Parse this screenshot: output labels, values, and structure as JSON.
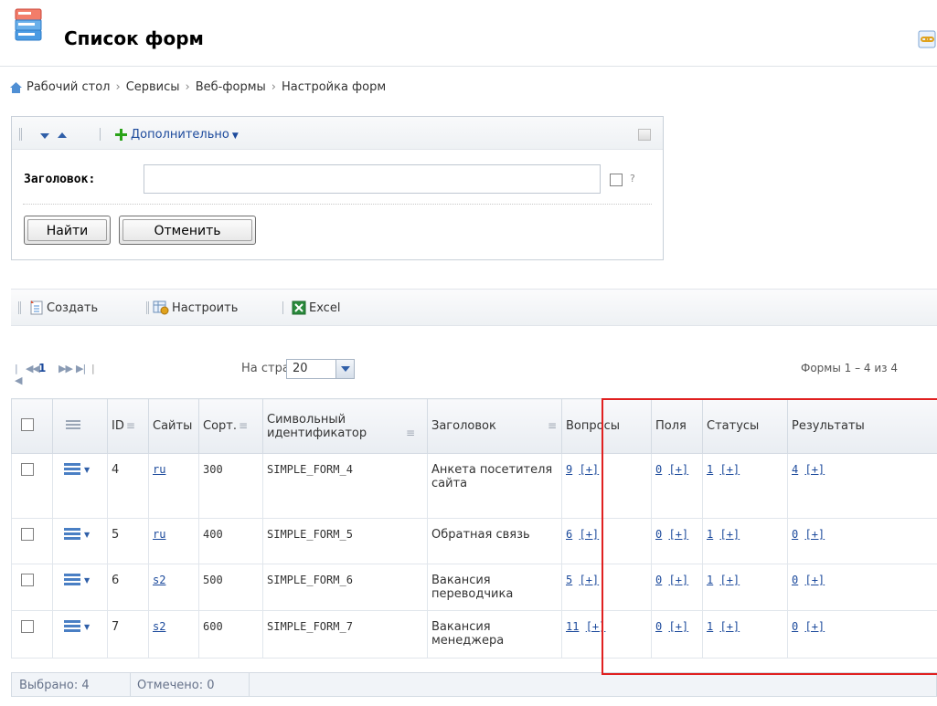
{
  "header": {
    "title": "Список форм"
  },
  "breadcrumb": [
    "Рабочий стол",
    "Сервисы",
    "Веб-формы",
    "Настройка форм"
  ],
  "filter": {
    "more_label": "Дополнительно",
    "title_label": "Заголовок:",
    "title_value": "",
    "help_mark": "?",
    "find_button": "Найти",
    "cancel_button": "Отменить"
  },
  "toolbar": {
    "create": "Создать",
    "configure": "Настроить",
    "excel": "Excel"
  },
  "pager": {
    "current_page": "1",
    "per_page_label": "На странице:",
    "per_page_value": "20",
    "summary": "Формы 1 – 4 из 4"
  },
  "table": {
    "columns": [
      "ID",
      "Сайты",
      "Сорт.",
      "Символьный идентификатор",
      "Заголовок",
      "Вопросы",
      "Поля",
      "Статусы",
      "Результаты"
    ],
    "rows": [
      {
        "id": "4",
        "site": "ru",
        "sort": "300",
        "sid": "SIMPLE_FORM_4",
        "title": "Анкета посетителя сайта",
        "questions": "9",
        "fields": "0",
        "statuses": "1",
        "results": "4"
      },
      {
        "id": "5",
        "site": "ru",
        "sort": "400",
        "sid": "SIMPLE_FORM_5",
        "title": "Обратная связь",
        "questions": "6",
        "fields": "0",
        "statuses": "1",
        "results": "0"
      },
      {
        "id": "6",
        "site": "s2",
        "sort": "500",
        "sid": "SIMPLE_FORM_6",
        "title": "Вакансия переводчика",
        "questions": "5",
        "fields": "0",
        "statuses": "1",
        "results": "0"
      },
      {
        "id": "7",
        "site": "s2",
        "sort": "600",
        "sid": "SIMPLE_FORM_7",
        "title": "Вакансия менеджера",
        "questions": "11",
        "fields": "0",
        "statuses": "1",
        "results": "0"
      }
    ],
    "add_link": "[+]"
  },
  "footer": {
    "selected": "Выбрано: 4",
    "checked": "Отмечено: 0"
  },
  "colors": {
    "link": "#1c4a9c",
    "highlight": "#e02020",
    "add_icon": "#2aa318"
  }
}
